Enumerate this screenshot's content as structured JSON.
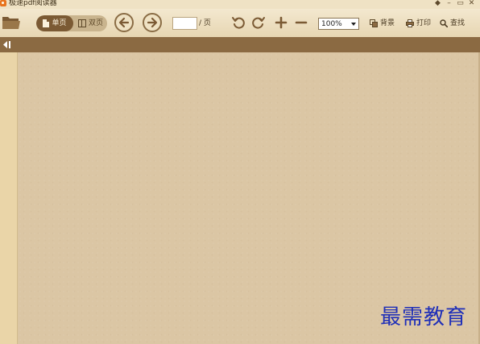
{
  "window": {
    "title": "极速pdf阅读器",
    "controls": [
      "◆",
      "–",
      "▭",
      "✕"
    ]
  },
  "toolbar": {
    "open_icon": "folder-icon",
    "view_single_label": "单页",
    "view_double_label": "双页",
    "prev_icon": "arrow-left-icon",
    "next_icon": "arrow-right-icon",
    "page_input_value": "",
    "page_separator": "/ 页",
    "rotate_ccw_icon": "rotate-ccw-icon",
    "rotate_cw_icon": "rotate-cw-icon",
    "zoom_in_icon": "plus-icon",
    "zoom_out_icon": "minus-icon",
    "zoom_value": "100%",
    "background_label": "背景",
    "print_label": "打印",
    "find_label": "查找"
  },
  "sidebar": {
    "toggle_icon": "sidebar-toggle-icon"
  },
  "watermark": {
    "text": "最需教育"
  },
  "colors": {
    "toolbar_bg": "#efe2c4",
    "accent_brown": "#7b5a34",
    "sidebar_bar": "#8b6a42",
    "document_bg": "#dbc6a4",
    "watermark": "#1f2fb8"
  }
}
